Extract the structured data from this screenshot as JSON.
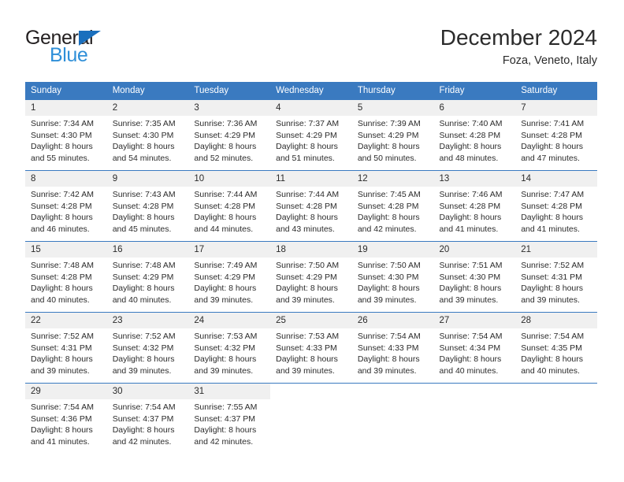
{
  "brand": {
    "name_dark": "General",
    "name_blue": "Blue",
    "triangle_color": "#1a6fbd",
    "blue_color": "#2f8fd8"
  },
  "header": {
    "month_title": "December 2024",
    "location": "Foza, Veneto, Italy"
  },
  "theme": {
    "header_bg": "#3a7ac0",
    "daynum_bg": "#f0f0f0",
    "grid_line": "#3a7ac0",
    "text": "#2b2b2b"
  },
  "weekdays": [
    "Sunday",
    "Monday",
    "Tuesday",
    "Wednesday",
    "Thursday",
    "Friday",
    "Saturday"
  ],
  "labels": {
    "sunrise_prefix": "Sunrise:",
    "sunset_prefix": "Sunset:",
    "daylight_prefix": "Daylight:"
  },
  "weeks": [
    [
      {
        "day": "1",
        "line1": "Sunrise: 7:34 AM",
        "line2": "Sunset: 4:30 PM",
        "line3": "Daylight: 8 hours",
        "line4": "and 55 minutes."
      },
      {
        "day": "2",
        "line1": "Sunrise: 7:35 AM",
        "line2": "Sunset: 4:30 PM",
        "line3": "Daylight: 8 hours",
        "line4": "and 54 minutes."
      },
      {
        "day": "3",
        "line1": "Sunrise: 7:36 AM",
        "line2": "Sunset: 4:29 PM",
        "line3": "Daylight: 8 hours",
        "line4": "and 52 minutes."
      },
      {
        "day": "4",
        "line1": "Sunrise: 7:37 AM",
        "line2": "Sunset: 4:29 PM",
        "line3": "Daylight: 8 hours",
        "line4": "and 51 minutes."
      },
      {
        "day": "5",
        "line1": "Sunrise: 7:39 AM",
        "line2": "Sunset: 4:29 PM",
        "line3": "Daylight: 8 hours",
        "line4": "and 50 minutes."
      },
      {
        "day": "6",
        "line1": "Sunrise: 7:40 AM",
        "line2": "Sunset: 4:28 PM",
        "line3": "Daylight: 8 hours",
        "line4": "and 48 minutes."
      },
      {
        "day": "7",
        "line1": "Sunrise: 7:41 AM",
        "line2": "Sunset: 4:28 PM",
        "line3": "Daylight: 8 hours",
        "line4": "and 47 minutes."
      }
    ],
    [
      {
        "day": "8",
        "line1": "Sunrise: 7:42 AM",
        "line2": "Sunset: 4:28 PM",
        "line3": "Daylight: 8 hours",
        "line4": "and 46 minutes."
      },
      {
        "day": "9",
        "line1": "Sunrise: 7:43 AM",
        "line2": "Sunset: 4:28 PM",
        "line3": "Daylight: 8 hours",
        "line4": "and 45 minutes."
      },
      {
        "day": "10",
        "line1": "Sunrise: 7:44 AM",
        "line2": "Sunset: 4:28 PM",
        "line3": "Daylight: 8 hours",
        "line4": "and 44 minutes."
      },
      {
        "day": "11",
        "line1": "Sunrise: 7:44 AM",
        "line2": "Sunset: 4:28 PM",
        "line3": "Daylight: 8 hours",
        "line4": "and 43 minutes."
      },
      {
        "day": "12",
        "line1": "Sunrise: 7:45 AM",
        "line2": "Sunset: 4:28 PM",
        "line3": "Daylight: 8 hours",
        "line4": "and 42 minutes."
      },
      {
        "day": "13",
        "line1": "Sunrise: 7:46 AM",
        "line2": "Sunset: 4:28 PM",
        "line3": "Daylight: 8 hours",
        "line4": "and 41 minutes."
      },
      {
        "day": "14",
        "line1": "Sunrise: 7:47 AM",
        "line2": "Sunset: 4:28 PM",
        "line3": "Daylight: 8 hours",
        "line4": "and 41 minutes."
      }
    ],
    [
      {
        "day": "15",
        "line1": "Sunrise: 7:48 AM",
        "line2": "Sunset: 4:28 PM",
        "line3": "Daylight: 8 hours",
        "line4": "and 40 minutes."
      },
      {
        "day": "16",
        "line1": "Sunrise: 7:48 AM",
        "line2": "Sunset: 4:29 PM",
        "line3": "Daylight: 8 hours",
        "line4": "and 40 minutes."
      },
      {
        "day": "17",
        "line1": "Sunrise: 7:49 AM",
        "line2": "Sunset: 4:29 PM",
        "line3": "Daylight: 8 hours",
        "line4": "and 39 minutes."
      },
      {
        "day": "18",
        "line1": "Sunrise: 7:50 AM",
        "line2": "Sunset: 4:29 PM",
        "line3": "Daylight: 8 hours",
        "line4": "and 39 minutes."
      },
      {
        "day": "19",
        "line1": "Sunrise: 7:50 AM",
        "line2": "Sunset: 4:30 PM",
        "line3": "Daylight: 8 hours",
        "line4": "and 39 minutes."
      },
      {
        "day": "20",
        "line1": "Sunrise: 7:51 AM",
        "line2": "Sunset: 4:30 PM",
        "line3": "Daylight: 8 hours",
        "line4": "and 39 minutes."
      },
      {
        "day": "21",
        "line1": "Sunrise: 7:52 AM",
        "line2": "Sunset: 4:31 PM",
        "line3": "Daylight: 8 hours",
        "line4": "and 39 minutes."
      }
    ],
    [
      {
        "day": "22",
        "line1": "Sunrise: 7:52 AM",
        "line2": "Sunset: 4:31 PM",
        "line3": "Daylight: 8 hours",
        "line4": "and 39 minutes."
      },
      {
        "day": "23",
        "line1": "Sunrise: 7:52 AM",
        "line2": "Sunset: 4:32 PM",
        "line3": "Daylight: 8 hours",
        "line4": "and 39 minutes."
      },
      {
        "day": "24",
        "line1": "Sunrise: 7:53 AM",
        "line2": "Sunset: 4:32 PM",
        "line3": "Daylight: 8 hours",
        "line4": "and 39 minutes."
      },
      {
        "day": "25",
        "line1": "Sunrise: 7:53 AM",
        "line2": "Sunset: 4:33 PM",
        "line3": "Daylight: 8 hours",
        "line4": "and 39 minutes."
      },
      {
        "day": "26",
        "line1": "Sunrise: 7:54 AM",
        "line2": "Sunset: 4:33 PM",
        "line3": "Daylight: 8 hours",
        "line4": "and 39 minutes."
      },
      {
        "day": "27",
        "line1": "Sunrise: 7:54 AM",
        "line2": "Sunset: 4:34 PM",
        "line3": "Daylight: 8 hours",
        "line4": "and 40 minutes."
      },
      {
        "day": "28",
        "line1": "Sunrise: 7:54 AM",
        "line2": "Sunset: 4:35 PM",
        "line3": "Daylight: 8 hours",
        "line4": "and 40 minutes."
      }
    ],
    [
      {
        "day": "29",
        "line1": "Sunrise: 7:54 AM",
        "line2": "Sunset: 4:36 PM",
        "line3": "Daylight: 8 hours",
        "line4": "and 41 minutes."
      },
      {
        "day": "30",
        "line1": "Sunrise: 7:54 AM",
        "line2": "Sunset: 4:37 PM",
        "line3": "Daylight: 8 hours",
        "line4": "and 42 minutes."
      },
      {
        "day": "31",
        "line1": "Sunrise: 7:55 AM",
        "line2": "Sunset: 4:37 PM",
        "line3": "Daylight: 8 hours",
        "line4": "and 42 minutes."
      },
      {
        "day": "",
        "line1": "",
        "line2": "",
        "line3": "",
        "line4": ""
      },
      {
        "day": "",
        "line1": "",
        "line2": "",
        "line3": "",
        "line4": ""
      },
      {
        "day": "",
        "line1": "",
        "line2": "",
        "line3": "",
        "line4": ""
      },
      {
        "day": "",
        "line1": "",
        "line2": "",
        "line3": "",
        "line4": ""
      }
    ]
  ]
}
